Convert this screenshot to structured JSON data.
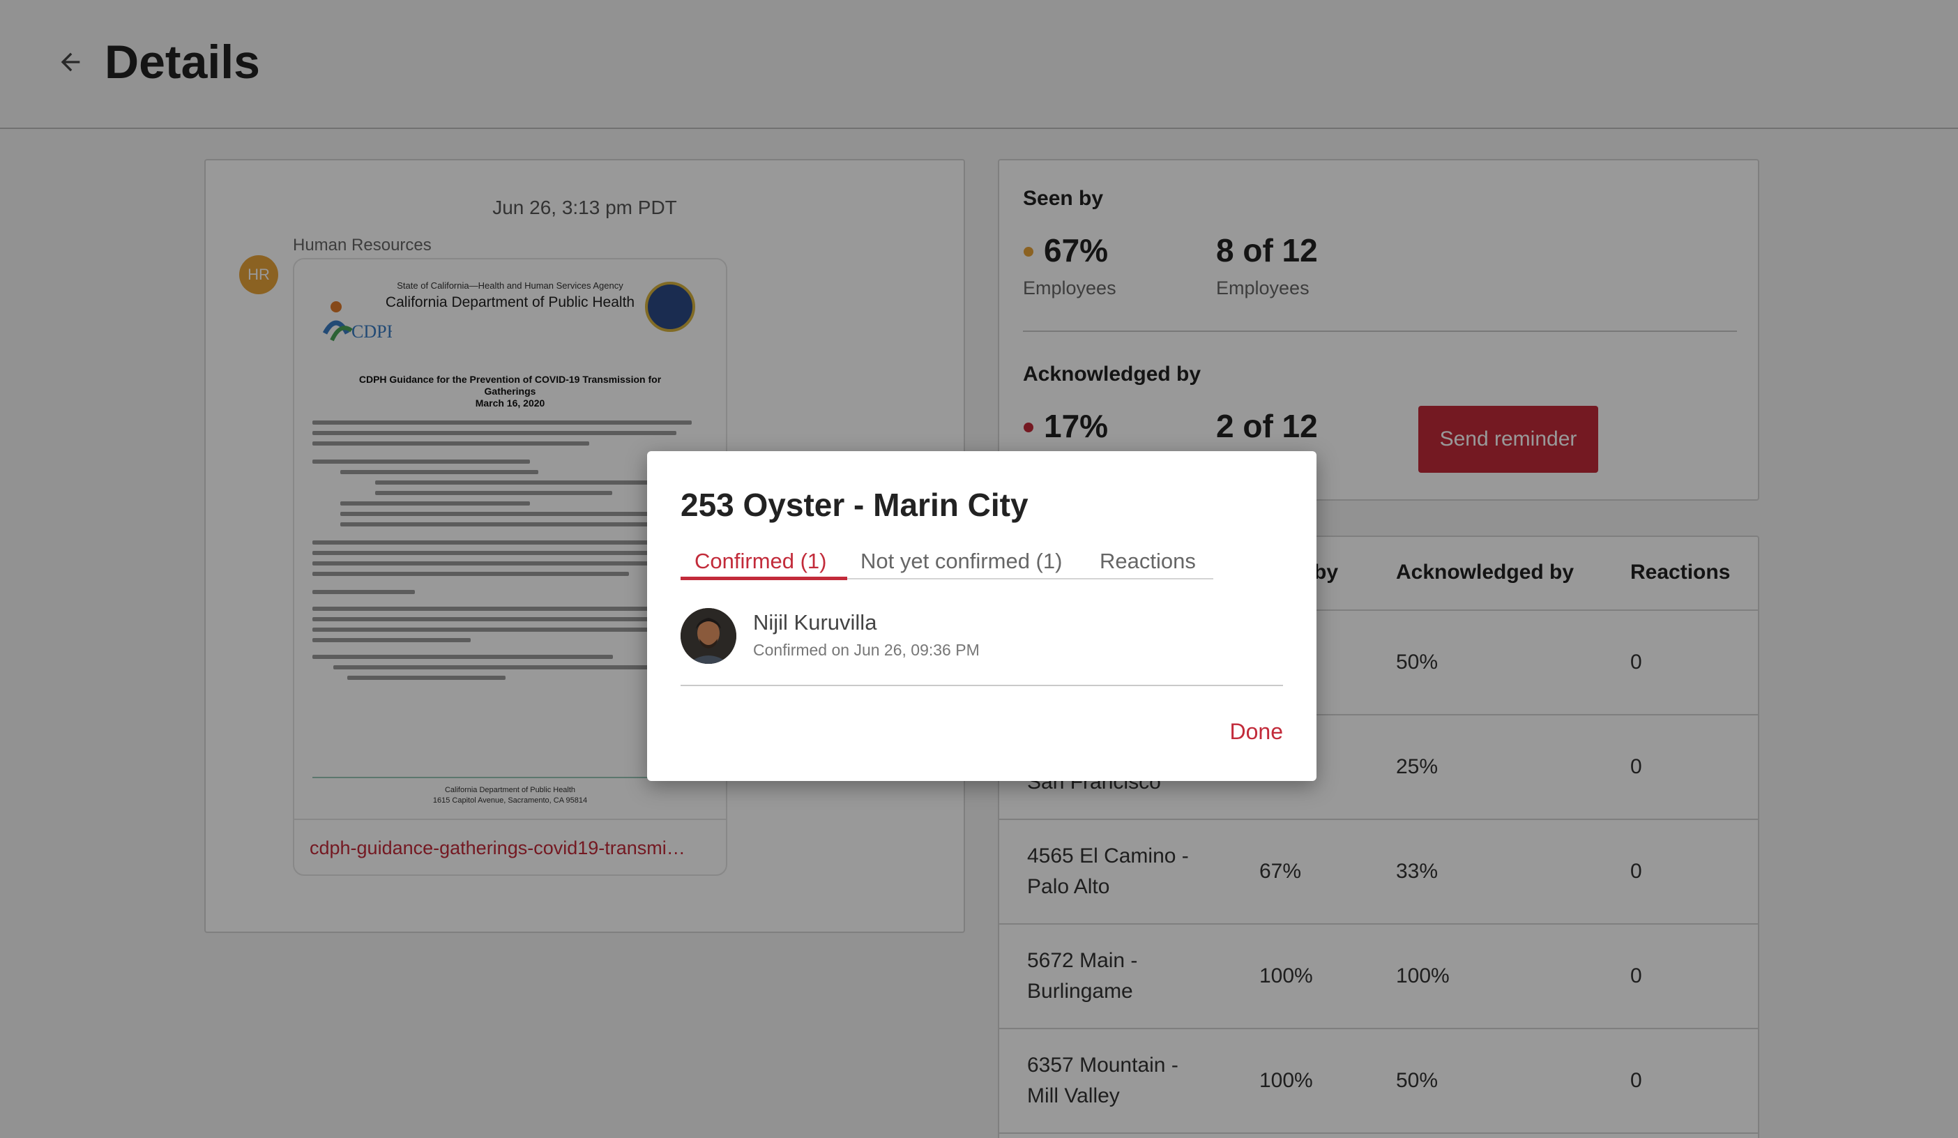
{
  "header": {
    "title": "Details",
    "back_icon": "arrow-left-icon"
  },
  "message": {
    "date": "Jun 26, 3:13 pm PDT",
    "sender": "Human Resources",
    "sender_initials": "HR",
    "sender_color": "#e8a33a",
    "attachment": {
      "file_name": "cdph-guidance-gatherings-covid19-transmi…",
      "preview": {
        "agency": "State of California—Health and Human Services Agency",
        "department": "California Department of Public Health",
        "title_line1": "CDPH Guidance for the Prevention of COVID-19 Transmission for",
        "title_line2": "Gatherings",
        "title_line3": "March 16, 2020",
        "footer_line1": "California Department of Public Health",
        "footer_line2": "1615 Capitol Avenue, Sacramento, CA 95814"
      }
    }
  },
  "stats": {
    "seen": {
      "heading": "Seen by",
      "percent": "67%",
      "percent_label": "Employees",
      "count": "8 of 12",
      "count_label": "Employees",
      "dot_color": "#e8a33a"
    },
    "acknowledged": {
      "heading": "Acknowledged by",
      "percent": "17%",
      "count": "2 of 12",
      "dot_color": "#c22b3a"
    },
    "send_reminder_label": "Send reminder",
    "accent": "#c22b3a"
  },
  "table": {
    "headers": {
      "seen": "by",
      "acknowledged": "Acknowledged by",
      "reactions": "Reactions"
    },
    "rows": [
      {
        "location_line1": "",
        "location_line2": "",
        "seen": "",
        "acknowledged": "50%",
        "reactions": "0"
      },
      {
        "location_line1": "",
        "location_line2": "San Francisco",
        "seen": "",
        "acknowledged": "25%",
        "reactions": "0"
      },
      {
        "location_line1": "4565 El Camino -",
        "location_line2": "Palo Alto",
        "seen": "67%",
        "acknowledged": "33%",
        "reactions": "0"
      },
      {
        "location_line1": "5672 Main -",
        "location_line2": "Burlingame",
        "seen": "100%",
        "acknowledged": "100%",
        "reactions": "0"
      },
      {
        "location_line1": "6357 Mountain -",
        "location_line2": "Mill Valley",
        "seen": "100%",
        "acknowledged": "50%",
        "reactions": "0"
      }
    ]
  },
  "modal": {
    "title": "253 Oyster - Marin City",
    "tabs": [
      {
        "label": "Confirmed (1)",
        "active": true
      },
      {
        "label": "Not yet confirmed (1)",
        "active": false
      },
      {
        "label": "Reactions",
        "active": false
      }
    ],
    "person": {
      "name": "Nijil Kuruvilla",
      "status": "Confirmed on Jun 26, 09:36 PM"
    },
    "done_label": "Done"
  }
}
